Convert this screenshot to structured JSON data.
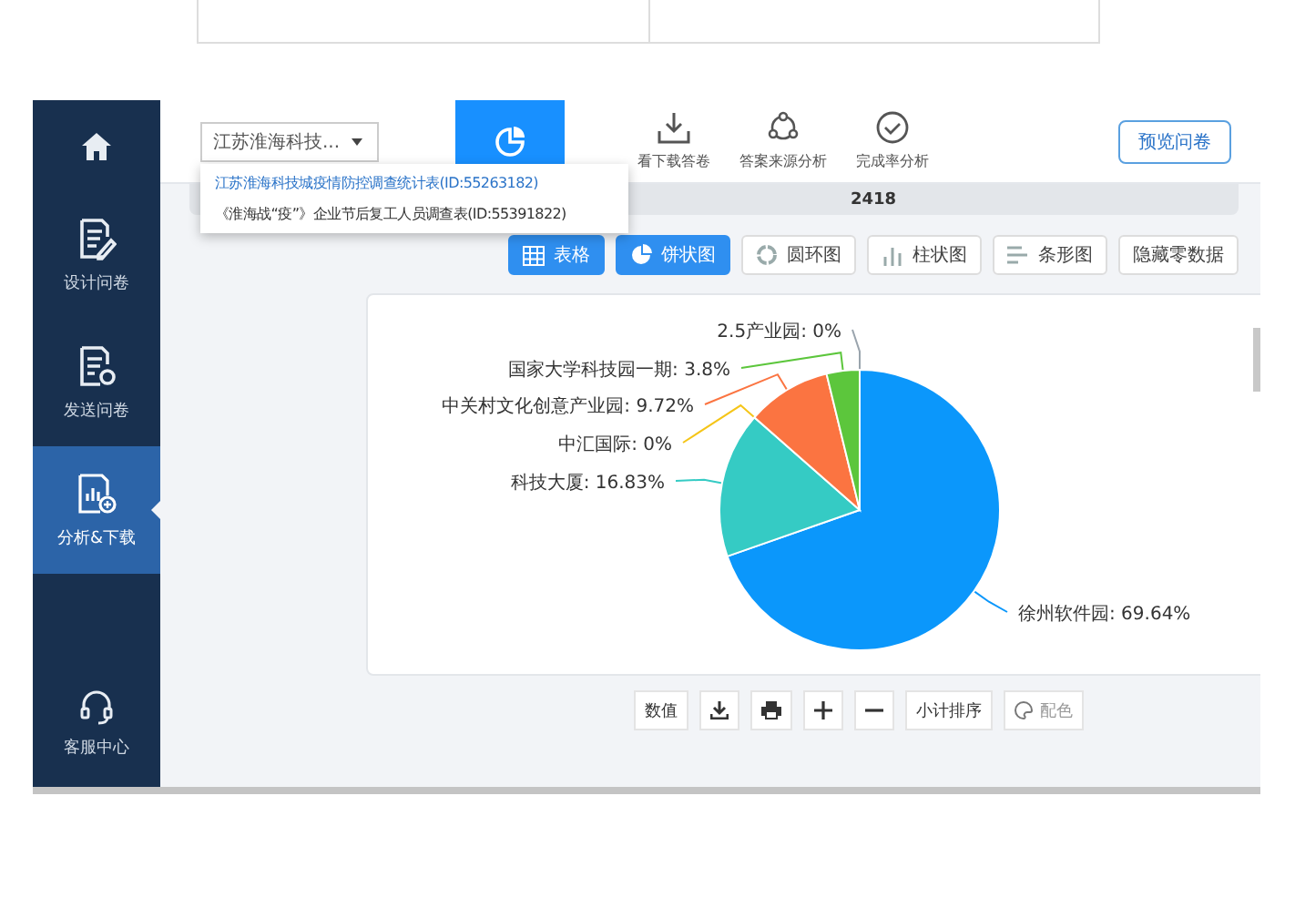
{
  "sidebar": {
    "items": [
      {
        "kind": "home",
        "selected": false
      },
      {
        "kind": "design",
        "label": "设计问卷",
        "selected": false
      },
      {
        "kind": "send",
        "label": "发送问卷",
        "selected": false
      },
      {
        "kind": "analysis",
        "label": "分析&下载",
        "selected": true
      },
      {
        "kind": "support",
        "label": "客服中心",
        "selected": false
      }
    ]
  },
  "survey_select": {
    "value": "江苏淮海科技...",
    "menu": [
      {
        "label": "江苏淮海科技城疫情防控调查统计表(ID:55263182)",
        "selected": true
      },
      {
        "label": "《淮海战“疫”》企业节后复工人员调查表(ID:55391822)",
        "selected": false
      }
    ]
  },
  "tabs": [
    {
      "kind": "stats",
      "selected": true
    },
    {
      "kind": "download",
      "label": "看下载答卷",
      "selected": false
    },
    {
      "kind": "source",
      "label": "答案来源分析",
      "selected": false
    },
    {
      "kind": "completion",
      "label": "完成率分析",
      "selected": false
    }
  ],
  "preview_button": "预览问卷",
  "summary": {
    "count": "2418"
  },
  "view_buttons": [
    {
      "kind": "table",
      "label": "表格",
      "selected": true
    },
    {
      "kind": "pie",
      "label": "饼状图",
      "selected": true
    },
    {
      "kind": "ring",
      "label": "圆环图",
      "selected": false
    },
    {
      "kind": "column",
      "label": "柱状图",
      "selected": false
    },
    {
      "kind": "bar",
      "label": "条形图",
      "selected": false
    },
    {
      "kind": "plain",
      "label": "隐藏零数据",
      "selected": false
    }
  ],
  "chart": {
    "chart_data": {
      "type": "pie",
      "values": [
        69.64,
        16.83,
        0,
        9.72,
        3.8,
        0
      ],
      "value_labels": [
        "徐州软件园: 69.64%",
        "科技大厦: 16.83%",
        "中汇国际: 0%",
        "中关村文化创意产业园: 9.72%",
        "国家大学科技园一期: 3.8%",
        "2.5产业园: 0%"
      ]
    }
  },
  "chart_tools": [
    {
      "kind": "text",
      "label": "数值",
      "disabled": false
    },
    {
      "kind": "download",
      "disabled": false
    },
    {
      "kind": "print",
      "disabled": false
    },
    {
      "kind": "plus",
      "disabled": false
    },
    {
      "kind": "minus",
      "disabled": false
    },
    {
      "kind": "text",
      "label": "小计排序",
      "disabled": false
    },
    {
      "kind": "palette",
      "label": "配色",
      "disabled": true
    }
  ]
}
